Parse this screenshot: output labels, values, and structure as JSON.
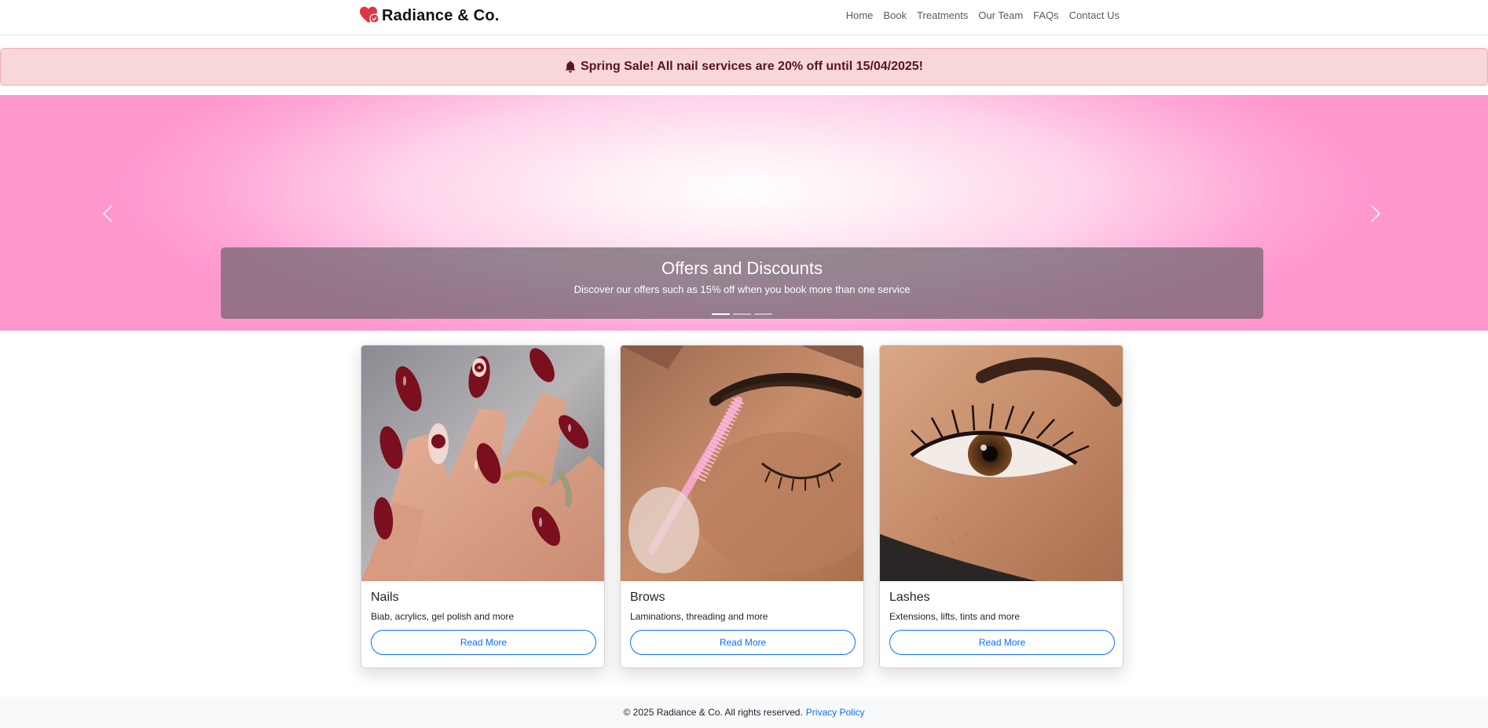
{
  "brand": {
    "name": "Radiance & Co.",
    "icon": "heart-icon",
    "accent": "#dc3545"
  },
  "nav": {
    "items": [
      {
        "label": "Home"
      },
      {
        "label": "Book"
      },
      {
        "label": "Treatments"
      },
      {
        "label": "Our Team"
      },
      {
        "label": "FAQs"
      },
      {
        "label": "Contact Us"
      }
    ]
  },
  "alert": {
    "icon": "bell-icon",
    "text": "Spring Sale! All nail services are 20% off until 15/04/2025!",
    "background": "#f8d7da",
    "color": "#58151c"
  },
  "carousel": {
    "caption_title": "Offers and Discounts",
    "caption_text": "Discover our offers such as 15% off when you book more than one service",
    "slide_count": 3,
    "active_slide": 1
  },
  "cards": [
    {
      "title": "Nails",
      "text": "Biab, acrylics, gel polish and more",
      "button": "Read More"
    },
    {
      "title": "Brows",
      "text": "Laminations, threading and more",
      "button": "Read More"
    },
    {
      "title": "Lashes",
      "text": "Extensions, lifts, tints and more",
      "button": "Read More"
    }
  ],
  "footer": {
    "text": "© 2025 Radiance & Co. All rights reserved.",
    "link": "Privacy Policy",
    "link_color": "#0d6efd"
  }
}
